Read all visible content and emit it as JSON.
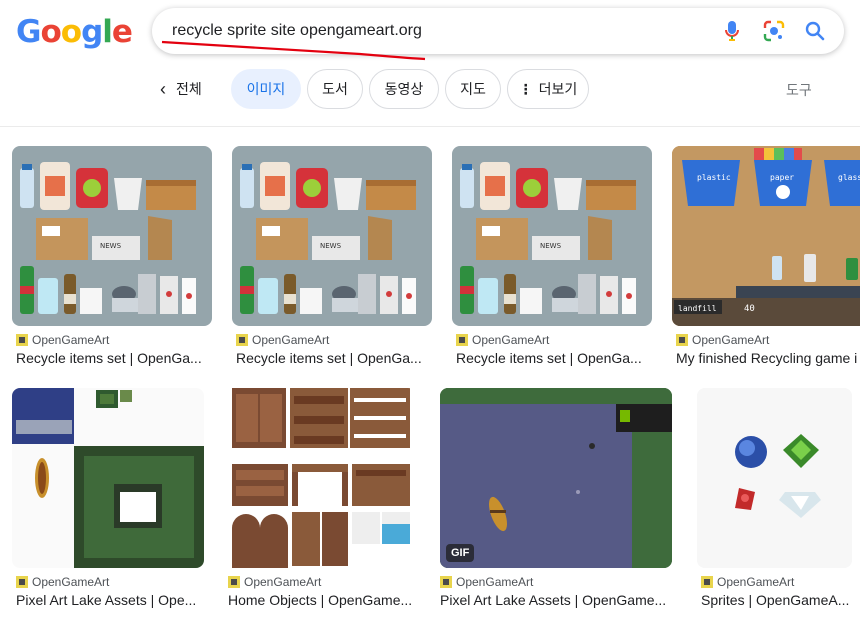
{
  "logo": {
    "letters": [
      "G",
      "o",
      "o",
      "g",
      "l",
      "e"
    ],
    "colors": [
      "#4285f4",
      "#ea4335",
      "#fbbc05",
      "#4285f4",
      "#34a853",
      "#ea4335"
    ]
  },
  "search": {
    "query": "recycle sprite site opengameart.org"
  },
  "filters": {
    "back_label": "전체",
    "chips": [
      {
        "label": "이미지",
        "active": true
      },
      {
        "label": "도서",
        "active": false
      },
      {
        "label": "동영상",
        "active": false
      },
      {
        "label": "지도",
        "active": false
      },
      {
        "label": "더보기",
        "active": false
      }
    ],
    "tools_label": "도구"
  },
  "results": [
    {
      "source": "OpenGameArt",
      "title": "Recycle items set | OpenGa..."
    },
    {
      "source": "OpenGameArt",
      "title": "Recycle items set | OpenGa..."
    },
    {
      "source": "OpenGameArt",
      "title": "Recycle items set | OpenGa..."
    },
    {
      "source": "OpenGameArt",
      "title": "My finished Recycling game i"
    },
    {
      "source": "OpenGameArt",
      "title": "Pixel Art Lake Assets | Ope..."
    },
    {
      "source": "OpenGameArt",
      "title": "Home Objects | OpenGame..."
    },
    {
      "source": "OpenGameArt",
      "title": "Pixel Art Lake Assets | OpenGame..."
    },
    {
      "source": "OpenGameArt",
      "title": "Sprites | OpenGameA..."
    }
  ],
  "thumb_labels": {
    "bin1": "plastic",
    "bin2": "paper",
    "bin3": "glass",
    "landfill": "landfill",
    "score": "40",
    "news": "NEWS",
    "gif": "GIF"
  },
  "colors": {
    "accent": "#1a73e8",
    "chip_active_bg": "#e8f0fe",
    "thumb_gray": "#95a5ab"
  }
}
